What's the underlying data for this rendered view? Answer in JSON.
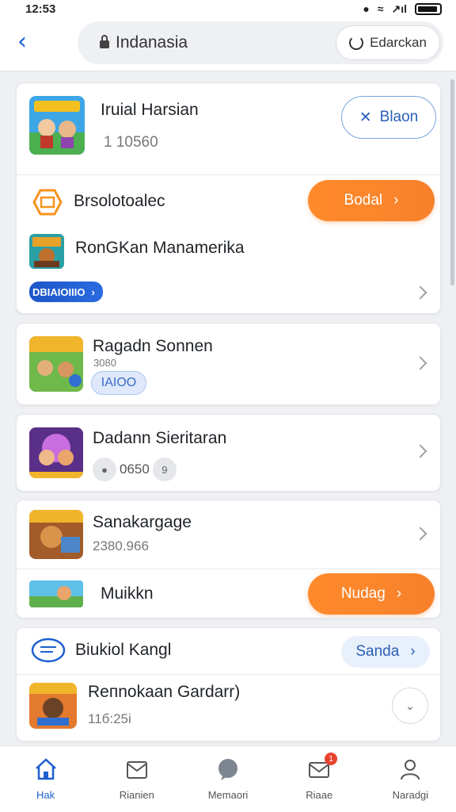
{
  "status_bar": {
    "time": "12:53",
    "signal": "↗ıl"
  },
  "header": {
    "search_text": "Indanasia",
    "refresh_label": "Edarckan"
  },
  "cards": {
    "c1": {
      "title": "Iruial Harsian",
      "meta": "1  10560",
      "button": "Blaon",
      "row2_label": "Brsolotoalec",
      "row2_button": "Bodal",
      "row3_title": "RonGKan Manamerika",
      "row3_tag": "DBIAIOIIIO"
    },
    "c2": {
      "title": "Ragadn Sonnen",
      "sub": "3080",
      "tag": "IAIOO"
    },
    "c3": {
      "title": "Dadann Sieritaran",
      "meta": "0650",
      "meta_badge": "9"
    },
    "c4": {
      "title": "Sanakargage",
      "sub": "2380.966",
      "row2_title": "Muikkn",
      "row2_button": "Nudag"
    },
    "c5": {
      "title": "Biukiol Kangl",
      "button": "Sanda",
      "row2_title": "Reпnokaan Gardarr)",
      "row2_sub": "11б:25і"
    }
  },
  "bottom_nav": [
    {
      "label": "Hak"
    },
    {
      "label": "Rianien"
    },
    {
      "label": "Memaori"
    },
    {
      "label": "Riaae",
      "badge": "1"
    },
    {
      "label": "Naradgi"
    }
  ],
  "colors": {
    "accent": "#1d5fd0",
    "orange": "#f7812b"
  }
}
